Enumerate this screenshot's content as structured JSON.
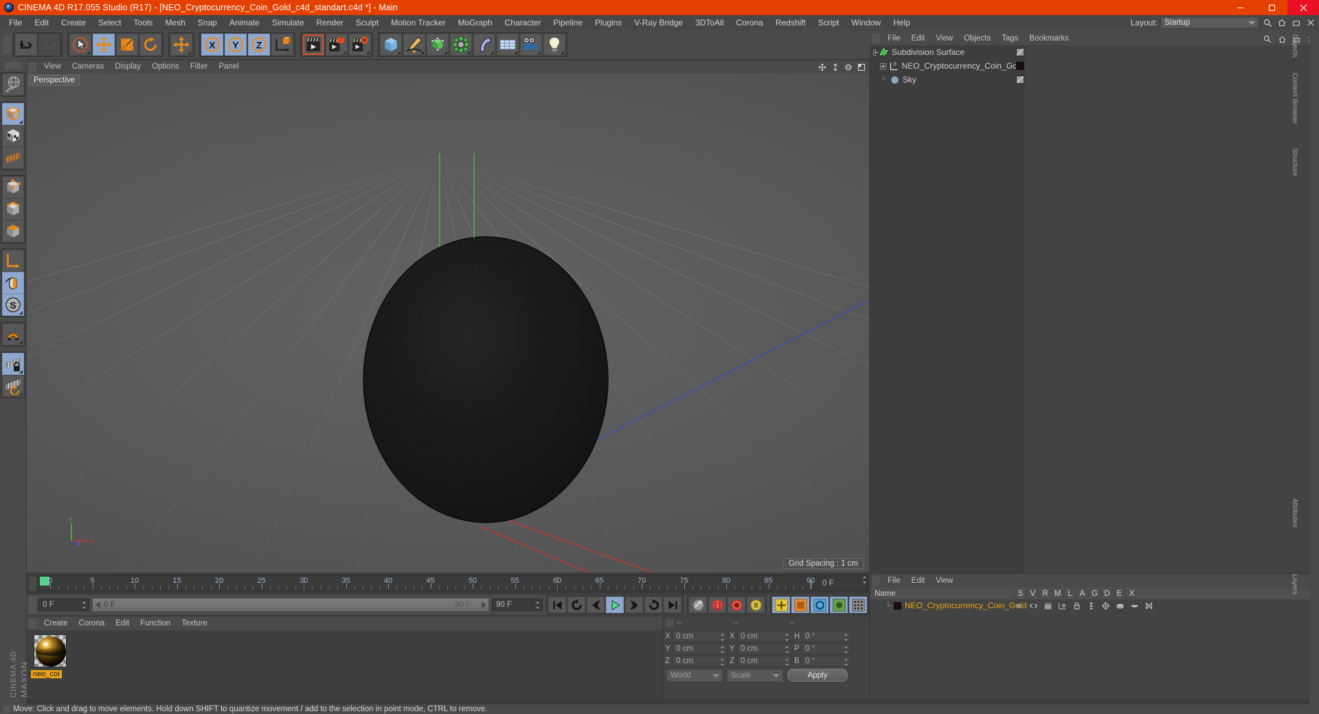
{
  "titlebar": {
    "title": "CINEMA 4D R17.055 Studio (R17) - [NEO_Cryptocurrency_Coin_Gold_c4d_standart.c4d *] - Main",
    "app_icon": "c4d-logo-icon",
    "minimize": "minimize-icon",
    "maximize": "maximize-icon",
    "close": "close-icon",
    "bg": "#e44000"
  },
  "menubar": {
    "items": [
      "File",
      "Edit",
      "Create",
      "Select",
      "Tools",
      "Mesh",
      "Snap",
      "Animate",
      "Simulate",
      "Render",
      "Sculpt",
      "Motion Tracker",
      "MoGraph",
      "Character",
      "Pipeline",
      "Plugins",
      "V-Ray Bridge",
      "3DToAll",
      "Corona",
      "Redshift",
      "Script",
      "Window",
      "Help"
    ],
    "layout_label": "Layout:",
    "layout_value": "Startup",
    "search_icon": "search-icon",
    "home_icon": "home-icon",
    "restore_icon": "restore-layout-icon",
    "close_icon": "close-layout-icon"
  },
  "toolbar": {
    "groups": [
      {
        "buttons": [
          {
            "name": "undo-button",
            "icon": "undo-arrow-icon",
            "active": false,
            "dim": false
          },
          {
            "name": "redo-button",
            "icon": "redo-arrow-icon",
            "active": false,
            "dim": true
          }
        ]
      },
      {
        "buttons": [
          {
            "name": "live-selection-tool",
            "icon": "cursor-circle-icon",
            "active": false,
            "dim": false,
            "corner": true
          },
          {
            "name": "move-tool",
            "icon": "move-arrows-icon",
            "active": true,
            "dim": false
          },
          {
            "name": "scale-tool",
            "icon": "scale-square-icon",
            "active": false,
            "dim": false
          },
          {
            "name": "rotate-tool",
            "icon": "rotate-circle-icon",
            "active": false,
            "dim": false
          }
        ]
      },
      {
        "buttons": [
          {
            "name": "move-duplicate-tool",
            "icon": "move-arrows-icon",
            "active": false,
            "dim": false,
            "corner": true
          }
        ]
      },
      {
        "buttons": [
          {
            "name": "axis-x-toggle",
            "icon": "x-axis-icon",
            "active": true,
            "dim": false
          },
          {
            "name": "axis-y-toggle",
            "icon": "y-axis-icon",
            "active": true,
            "dim": false
          },
          {
            "name": "axis-z-toggle",
            "icon": "z-axis-icon",
            "active": true,
            "dim": false
          },
          {
            "name": "world-object-coordinate-toggle",
            "icon": "world-axis-cube-icon",
            "active": false,
            "dim": false
          }
        ]
      },
      {
        "buttons": [
          {
            "name": "render-view-button",
            "icon": "clapper-play-icon",
            "active": false,
            "dim": false,
            "framed": true
          },
          {
            "name": "render-region-button",
            "icon": "clapper-region-icon",
            "active": false,
            "dim": false,
            "corner": true
          },
          {
            "name": "render-settings-button",
            "icon": "clapper-gear-icon",
            "active": false,
            "dim": false,
            "corner": true
          }
        ]
      },
      {
        "buttons": [
          {
            "name": "add-cube-button",
            "icon": "cube-primitive-icon",
            "active": false,
            "dim": false,
            "corner": true
          },
          {
            "name": "add-spline-button",
            "icon": "pen-spline-icon",
            "active": false,
            "dim": false,
            "corner": true
          },
          {
            "name": "add-generator-button",
            "icon": "green-cube-generator-icon",
            "active": false,
            "dim": false,
            "corner": true
          },
          {
            "name": "add-mograph-button",
            "icon": "cloner-icon",
            "active": false,
            "dim": false,
            "corner": true
          },
          {
            "name": "add-deformer-button",
            "icon": "bend-deformer-icon",
            "active": false,
            "dim": false,
            "corner": true
          },
          {
            "name": "add-scene-object-button",
            "icon": "floor-grid-icon",
            "active": false,
            "dim": false,
            "corner": true
          },
          {
            "name": "add-camera-button",
            "icon": "camera-icon",
            "active": false,
            "dim": false,
            "corner": true
          },
          {
            "name": "add-light-button",
            "icon": "light-bulb-icon",
            "active": false,
            "dim": false,
            "corner": true
          }
        ]
      }
    ]
  },
  "lefttoolbar": {
    "groups": [
      [
        {
          "name": "undo-view-button",
          "icon": "globe-wireframe-icon",
          "active": false
        }
      ],
      [
        {
          "name": "model-mode-button",
          "icon": "model-cube-icon",
          "active": true,
          "corner": true
        },
        {
          "name": "texture-mode-button",
          "icon": "texture-checker-cube-icon",
          "active": false
        },
        {
          "name": "workplane-mode-button",
          "icon": "workplane-grid-icon",
          "active": false
        }
      ],
      [
        {
          "name": "points-mode-button",
          "icon": "point-cube-icon",
          "active": false
        },
        {
          "name": "edges-mode-button",
          "icon": "edge-cube-icon",
          "active": false
        },
        {
          "name": "polygons-mode-button",
          "icon": "polygon-cube-icon",
          "active": false
        }
      ],
      [
        {
          "name": "object-axis-mode-button",
          "icon": "axis-arrow-icon",
          "active": false
        },
        {
          "name": "viewport-solo-button",
          "icon": "mouse-icon",
          "active": true
        },
        {
          "name": "enable-snap-button",
          "icon": "s-circle-icon",
          "active": true,
          "corner": true
        }
      ],
      [
        {
          "name": "magnet-tool-button",
          "icon": "magnet-icon",
          "active": false,
          "corner": true
        }
      ],
      [
        {
          "name": "lock-workplane-button",
          "icon": "grid-lock-icon",
          "active": true,
          "corner": true
        },
        {
          "name": "workplane-rotate-button",
          "icon": "grid-rotate-icon",
          "active": false,
          "corner": true
        }
      ]
    ],
    "brand_top": "MAXON",
    "brand_bottom": "CINEMA 4D"
  },
  "viewport": {
    "menu": [
      "View",
      "Cameras",
      "Display",
      "Options",
      "Filter",
      "Panel"
    ],
    "label": "Perspective",
    "grid_spacing": "Grid Spacing : 1 cm",
    "corner_icons": [
      "move-camera-icon",
      "scale-camera-icon",
      "rotate-camera-icon",
      "maximize-view-icon"
    ],
    "axis_gizmo": {
      "x": "X",
      "y": "Y",
      "z": "Z"
    },
    "object_color": "#141414"
  },
  "object_manager": {
    "menu": [
      "File",
      "Edit",
      "View",
      "Objects",
      "Tags",
      "Bookmarks"
    ],
    "right_icons": [
      "search-icon",
      "home-icon",
      "restore-icon",
      "close-icon"
    ],
    "rows": [
      {
        "name": "Subdivision Surface",
        "indent": 0,
        "icon": "subdivision-surface-icon",
        "expander": "minus",
        "tag_swatch": "hatched",
        "check": true,
        "selected": false
      },
      {
        "name": "NEO_Cryptocurrency_Coin_Gold",
        "indent": 1,
        "icon": "polygon-object-icon",
        "expander": "plus",
        "tag_swatch": "#1d0a18",
        "check": false,
        "selected": false
      },
      {
        "name": "Sky",
        "indent": 1,
        "icon": "sky-sphere-icon",
        "expander": "none",
        "tag_swatch": "hatched",
        "check": false,
        "dot": "#e8553c",
        "selected": false
      }
    ]
  },
  "timeline": {
    "ticks": [
      "0",
      "5",
      "10",
      "15",
      "20",
      "25",
      "30",
      "35",
      "40",
      "45",
      "50",
      "55",
      "60",
      "65",
      "70",
      "75",
      "80",
      "85",
      "90"
    ],
    "current_frame_field": "0 F",
    "start_field": "0 F",
    "scrub_value": "0 F",
    "end_label": "90 F",
    "end_field": "90 F",
    "playhead": 0,
    "range_start": 0,
    "range_end": 90
  },
  "animbar": {
    "transport": [
      {
        "name": "go-to-start-button",
        "icon": "skip-start-icon"
      },
      {
        "name": "play-backward-button",
        "icon": "rewind-loop-icon"
      },
      {
        "name": "previous-key-button",
        "icon": "prev-key-icon"
      },
      {
        "name": "play-button",
        "icon": "play-icon",
        "active": true
      },
      {
        "name": "next-key-button",
        "icon": "next-key-icon"
      },
      {
        "name": "loop-button",
        "icon": "loop-arrow-icon"
      },
      {
        "name": "go-to-end-button",
        "icon": "skip-end-icon"
      }
    ],
    "record": [
      {
        "name": "autokey-button",
        "icon": "key-circle-icon"
      },
      {
        "name": "record-active-objects-button",
        "icon": "record-red-icon"
      },
      {
        "name": "autokeying-button",
        "icon": "autokey-red-icon"
      },
      {
        "name": "keyframe-selection-button",
        "icon": "key-yellow-icon"
      }
    ],
    "params": [
      {
        "name": "position-key-button",
        "icon": "position-key-icon",
        "active": true
      },
      {
        "name": "scale-key-button",
        "icon": "scale-key-icon",
        "active": true
      },
      {
        "name": "rotation-key-button",
        "icon": "rotation-key-icon",
        "active": true
      },
      {
        "name": "param-key-button",
        "icon": "param-key-icon",
        "active": true
      },
      {
        "name": "point-level-anim-button",
        "icon": "pla-icon",
        "active": true
      }
    ]
  },
  "material_manager": {
    "menu": [
      "Create",
      "Corona",
      "Edit",
      "Function",
      "Texture"
    ],
    "materials": [
      {
        "name": "neo_coi",
        "selected": true,
        "preview": "gold-sphere-preview"
      }
    ]
  },
  "coordinates": {
    "headers": [
      "--",
      "--",
      "--"
    ],
    "rows": [
      {
        "l1": "X",
        "v1": "0 cm",
        "l2": "X",
        "v2": "0 cm",
        "l3": "H",
        "v3": "0 °"
      },
      {
        "l1": "Y",
        "v1": "0 cm",
        "l2": "Y",
        "v2": "0 cm",
        "l3": "P",
        "v3": "0 °"
      },
      {
        "l1": "Z",
        "v1": "0 cm",
        "l2": "Z",
        "v2": "0 cm",
        "l3": "B",
        "v3": "0 °"
      }
    ],
    "system": "World",
    "mode": "Scale",
    "apply": "Apply"
  },
  "attribute_manager": {
    "menu": [
      "File",
      "Edit",
      "View"
    ],
    "columns": [
      "Name",
      "S",
      "V",
      "R",
      "M",
      "L",
      "A",
      "G",
      "D",
      "E",
      "X"
    ],
    "rows": [
      {
        "name": "NEO_Cryptocurrency_Coin_Gold",
        "swatch": "#1d0a18",
        "icons": [
          "dot-grey-icon",
          "visible-editor-icon",
          "visible-render-icon",
          "deform-icon",
          "lock-icon",
          "align-icon",
          "generator-icon",
          "deformer-icon",
          "cap-icon",
          "x-ray-icon"
        ]
      }
    ]
  },
  "statusbar": {
    "text": "Move: Click and drag to move elements. Hold down SHIFT to quantize movement / add to the selection in point mode, CTRL to remove."
  },
  "right_dock": {
    "labels": [
      "Objects",
      "Content Browser",
      "Structure",
      "Attributes",
      "Layers"
    ]
  }
}
